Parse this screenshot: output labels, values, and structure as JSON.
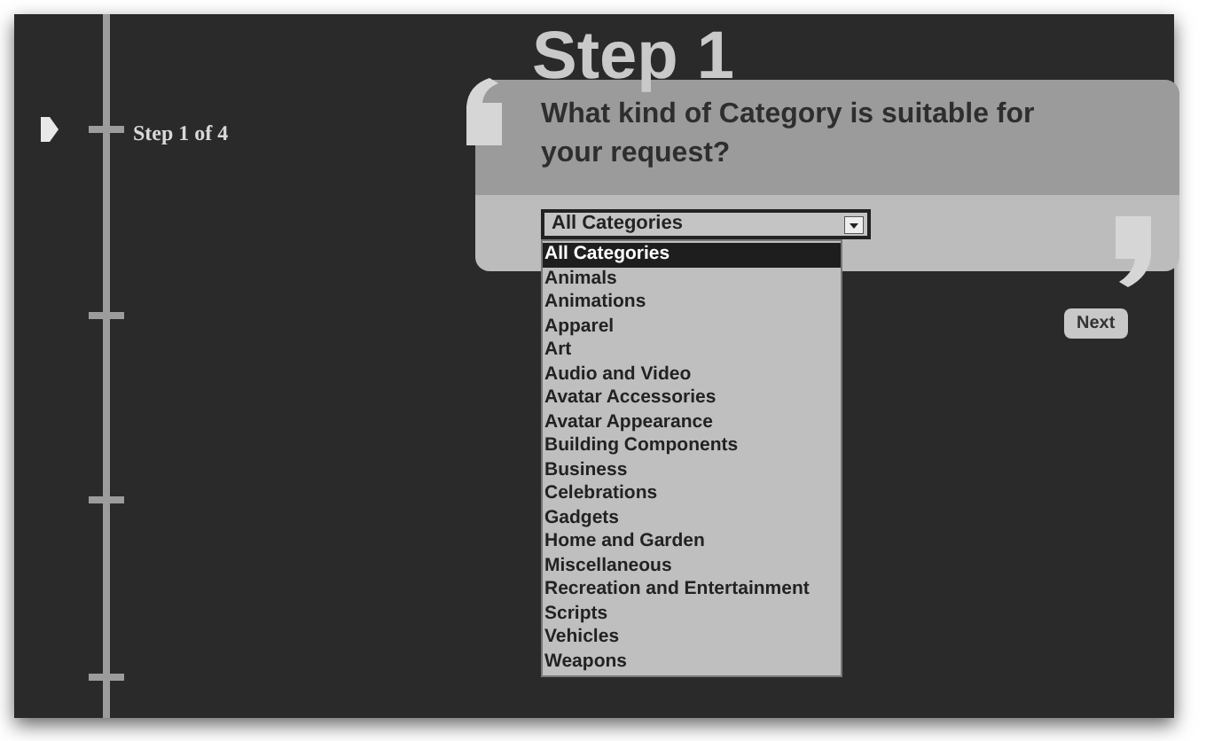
{
  "progress": {
    "label": "Step 1 of 4"
  },
  "title": "Step 1",
  "question": "What kind of Category is suitable for your request?",
  "category_select": {
    "value": "All Categories",
    "expanded": true,
    "options": [
      {
        "label": "All Categories",
        "selected": true
      },
      {
        "label": "Animals",
        "selected": false
      },
      {
        "label": "Animations",
        "selected": false
      },
      {
        "label": "Apparel",
        "selected": false
      },
      {
        "label": "Art",
        "selected": false
      },
      {
        "label": "Audio and Video",
        "selected": false
      },
      {
        "label": "Avatar Accessories",
        "selected": false
      },
      {
        "label": "Avatar Appearance",
        "selected": false
      },
      {
        "label": "Building Components",
        "selected": false
      },
      {
        "label": "Business",
        "selected": false
      },
      {
        "label": "Celebrations",
        "selected": false
      },
      {
        "label": "Gadgets",
        "selected": false
      },
      {
        "label": "Home and Garden",
        "selected": false
      },
      {
        "label": "Miscellaneous",
        "selected": false
      },
      {
        "label": "Recreation and Entertainment",
        "selected": false
      },
      {
        "label": "Scripts",
        "selected": false
      },
      {
        "label": "Vehicles",
        "selected": false
      },
      {
        "label": "Weapons",
        "selected": false
      }
    ]
  },
  "buttons": [
    {
      "label": "Next"
    }
  ]
}
